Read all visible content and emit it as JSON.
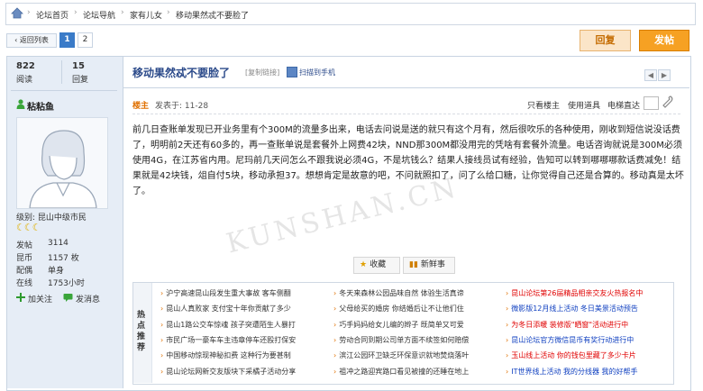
{
  "breadcrumb": {
    "items": [
      "论坛首页",
      "论坛导航",
      "家有儿女",
      "移动果然忒不要脸了"
    ]
  },
  "pager": {
    "back_label": "‹ 返回列表",
    "pages": [
      "1",
      "2"
    ],
    "current": "1",
    "reply_label": "回复",
    "post_label": "发帖"
  },
  "author": {
    "stats": [
      {
        "value": "822",
        "label": "阅读"
      },
      {
        "value": "15",
        "label": "回复"
      }
    ],
    "name": "粘粘鱼",
    "level": "级别: 昆山中级市民",
    "rows": [
      {
        "label": "发帖",
        "value": "3114"
      },
      {
        "label": "昆币",
        "value": "1157 枚"
      },
      {
        "label": "配偶",
        "value": "单身"
      },
      {
        "label": "在线",
        "value": "1753小时"
      }
    ],
    "add_follow": "加关注",
    "send_msg": "发消息"
  },
  "post": {
    "title": "移动果然忒不要脸了",
    "copy_link": "[复制链接]",
    "scan_mobile": "扫描到手机",
    "floor": "楼主",
    "posted_at": "发表于: 11-28",
    "only_op": "只看楼主",
    "use_tool": "使用道具",
    "goto_floor": "电梯直达",
    "body": "前几日查账单发现已开业务里有个300M的流量多出来，电话去问说是送的就只有这个月有，然后很吹乐的各种使用，刚收到短信说没话费了，明明前2天还有60多的，再一查账单说是套餐外上网费42块，NND那300M都没用完的凭啥有套餐外流量。电话咨询就说是300M必须使用4G，在江苏省内用。尼玛前几天问怎么不跟我说必须4G，不是坑钱么？结果人接线员试有经验，告知可以转到哪哪哪款话费减免！结果就是42块钱，俎自付5块，移动承担37。想想肯定是故意的吧，不问就照扣了，问了么给口糖，让你觉得自己还是合算的。移动真是太坏了。",
    "watermark": "KUNSHAN.CN",
    "collect_label": "收藏",
    "news_label": "新鲜事"
  },
  "hot": {
    "label": "热点推荐",
    "col1": [
      "沪宁高速昆山段发生重大事故 客车侧翻",
      "昆山人真败家 支付宝十年你贡献了多少",
      "昆山1路公交车惊魂 孩子突遭陌生人暴打",
      "市民广场一豪车车主违章停车还殴打保安",
      "中国移动惊现神秘扣费 这种行为要甚制",
      "昆山论坛网新交友版块下采橘子活动分享"
    ],
    "col2": [
      "冬天来森林公园品味自然 体验生活真谛",
      "父母给买的婚房 你结婚后让不让他们住",
      "巧手妈妈给女儿编的辫子 既简单又可爱",
      "劳动合同到期公司单方面不续签如何赔偿",
      "滨江公园环卫缺乏环保意识就地焚烧落叶",
      "祖冲之路迎宾路口看见被撞的还睡在地上"
    ],
    "col3": [
      "昆山论坛第26届精品相亲交友火热报名中",
      "微影版12月线上活动 冬日美景活动预告",
      "为冬日添暖 装修版\"晒窗\"活动进行中",
      "昆山论坛官方微信昆币有奖行动进行中",
      "玉山线上活动 你的钱包里藏了多少卡片",
      "IT世界线上活动 我的分线器 我的好帮手"
    ],
    "col3_colors": [
      "#e00000",
      "#1040c0",
      "#e00000",
      "#1040c0",
      "#e00000",
      "#1040c0"
    ]
  },
  "colors": {
    "accent": "#f6a123",
    "title_blue": "#2b4a8a",
    "side_bg": "#e6edf6"
  }
}
